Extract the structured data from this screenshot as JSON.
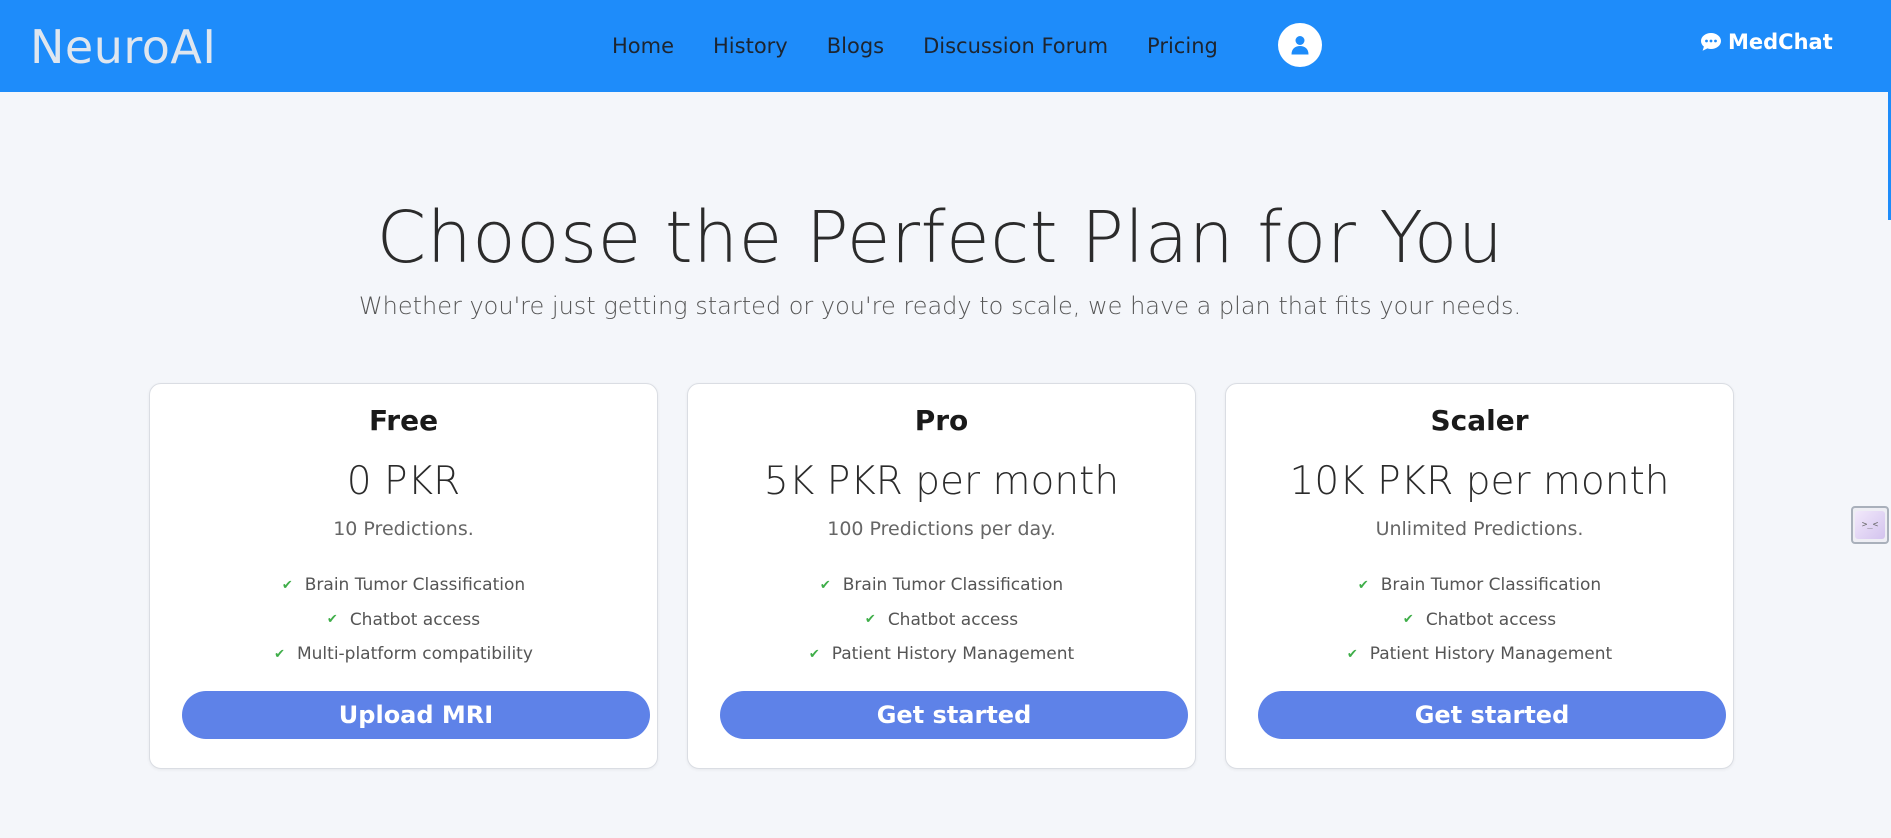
{
  "navbar": {
    "brand": "NeuroAI",
    "links": [
      "Home",
      "History",
      "Blogs",
      "Discussion Forum",
      "Pricing"
    ],
    "user_icon": "user-icon",
    "medchat_label": "MedChat",
    "medchat_icon": "chat-bubble-icon",
    "background_color": "#1e8cfa"
  },
  "hero": {
    "title": "Choose the Perfect Plan for You",
    "subtitle": "Whether you're just getting started or you're ready to scale, we have a plan that fits your needs."
  },
  "plans": [
    {
      "name": "Free",
      "price": "0 PKR",
      "quota": "10 Predictions.",
      "features": [
        "Brain Tumor Classification",
        "Chatbot access",
        "Multi-platform compatibility"
      ],
      "button": "Upload MRI"
    },
    {
      "name": "Pro",
      "price": "5K PKR per month",
      "quota": "100 Predictions per day.",
      "features": [
        "Brain Tumor Classification",
        "Chatbot access",
        "Patient History Management"
      ],
      "button": "Get started"
    },
    {
      "name": "Scaler",
      "price": "10K PKR per month",
      "quota": "Unlimited Predictions.",
      "features": [
        "Brain Tumor Classification",
        "Chatbot access",
        "Patient History Management"
      ],
      "button": "Get started"
    }
  ],
  "colors": {
    "accent_button": "#5e82e8",
    "check": "#3fae49",
    "page_background": "#f4f6fa"
  },
  "side_widget": {
    "glyph": ">_<"
  }
}
